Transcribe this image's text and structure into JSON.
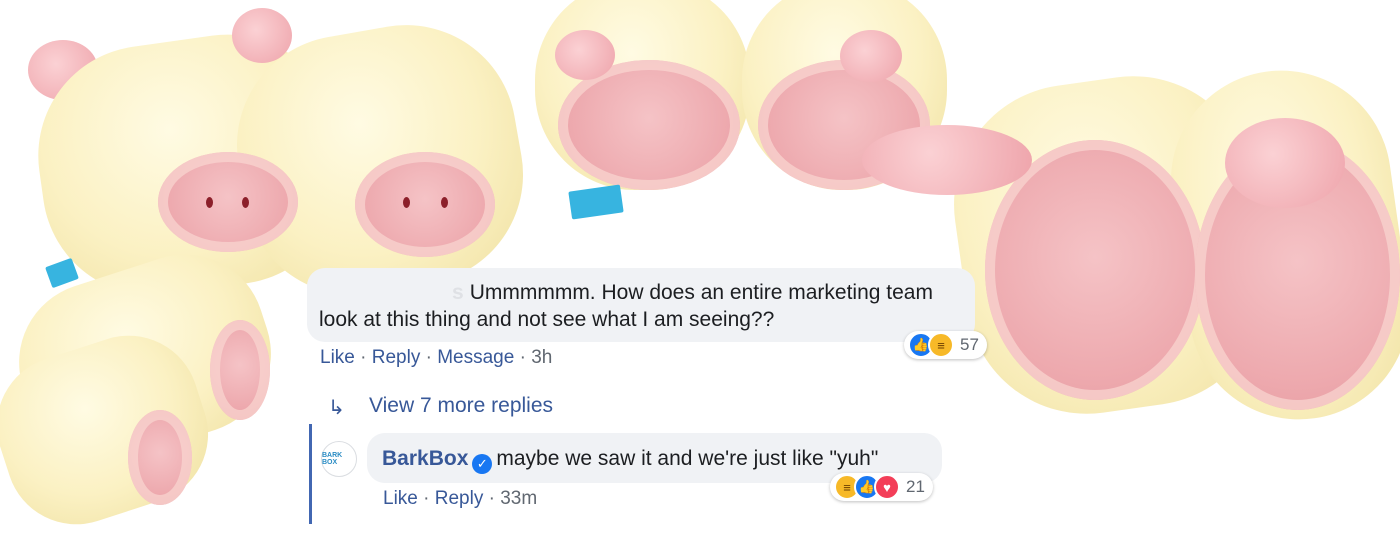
{
  "comment1": {
    "author_partial": "s",
    "text_line1": "Ummmmmm. How does an entire marketing team",
    "text_line2": "look at this thing and not see what I am seeing??",
    "actions": {
      "like": "Like",
      "reply": "Reply",
      "message": "Message",
      "sep": "·",
      "time": "3h"
    },
    "reactions": {
      "count": "57",
      "types": [
        "like-icon",
        "haha-icon"
      ]
    }
  },
  "view_replies": {
    "label": "View 7 more replies",
    "icon": "reply-arrow-icon"
  },
  "reply": {
    "avatar_label": "BARK BOX",
    "author": "BarkBox",
    "verified_icon": "verified-badge-icon",
    "text": "maybe we saw it and we're just like \"yuh\"",
    "actions": {
      "like": "Like",
      "reply": "Reply",
      "sep": "·",
      "time": "33m"
    },
    "reactions": {
      "count": "21",
      "types": [
        "haha-icon",
        "like-icon",
        "love-icon"
      ]
    }
  },
  "colors": {
    "link": "#385898",
    "bubble": "#f0f2f5",
    "like": "#1877f2",
    "haha": "#f7b928",
    "love": "#f33e58",
    "thread_line": "#4267b2"
  }
}
